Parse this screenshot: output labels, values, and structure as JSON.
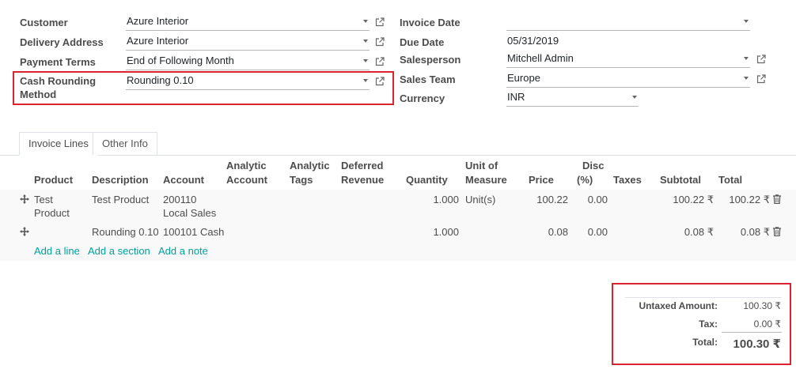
{
  "form": {
    "customer_label": "Customer",
    "customer_value": "Azure Interior",
    "delivery_label": "Delivery Address",
    "delivery_value": "Azure Interior",
    "payment_label": "Payment Terms",
    "payment_value": "End of Following Month",
    "rounding_label_1": "Cash Rounding",
    "rounding_label_2": "Method",
    "rounding_value": "Rounding 0.10",
    "invoice_date_label": "Invoice Date",
    "invoice_date_value": "",
    "due_date_label": "Due Date",
    "due_date_value": "05/31/2019",
    "salesperson_label": "Salesperson",
    "salesperson_value": "Mitchell Admin",
    "sales_team_label": "Sales Team",
    "sales_team_value": "Europe",
    "currency_label": "Currency",
    "currency_value": "INR"
  },
  "tabs": [
    {
      "label": "Invoice Lines",
      "active": true
    },
    {
      "label": "Other Info",
      "active": false
    }
  ],
  "table": {
    "headers": {
      "product": "Product",
      "description": "Description",
      "account": "Account",
      "analytic_account_1": "Analytic",
      "analytic_account_2": "Account",
      "analytic_tags_1": "Analytic",
      "analytic_tags_2": "Tags",
      "deferred_1": "Deferred",
      "deferred_2": "Revenue",
      "quantity": "Quantity",
      "uom_1": "Unit of",
      "uom_2": "Measure",
      "price": "Price",
      "disc_1": "Disc",
      "disc_2": "(%)",
      "taxes": "Taxes",
      "subtotal": "Subtotal",
      "total": "Total"
    },
    "rows": [
      {
        "product_1": "Test",
        "product_2": "Product",
        "description": "Test Product",
        "account_1": "200110",
        "account_2": "Local Sales",
        "quantity": "1.000",
        "uom": "Unit(s)",
        "price": "100.22",
        "disc": "0.00",
        "subtotal": "100.22 ₹",
        "total": "100.22 ₹"
      },
      {
        "product_1": "",
        "description": "Rounding 0.10",
        "account_1": "100101 Cash",
        "quantity": "1.000",
        "uom": "",
        "price": "0.08",
        "disc": "0.00",
        "subtotal": "0.08 ₹",
        "total": "0.08 ₹"
      }
    ],
    "add_line": "Add a line",
    "add_section": "Add a section",
    "add_note": "Add a note"
  },
  "totals": {
    "untaxed_label": "Untaxed Amount:",
    "untaxed_value": "100.30 ₹",
    "tax_label": "Tax:",
    "tax_value": "0.00 ₹",
    "total_label": "Total:",
    "total_value": "100.30 ₹"
  },
  "colors": {
    "highlight": "#d9232d",
    "link": "#00a09d"
  }
}
